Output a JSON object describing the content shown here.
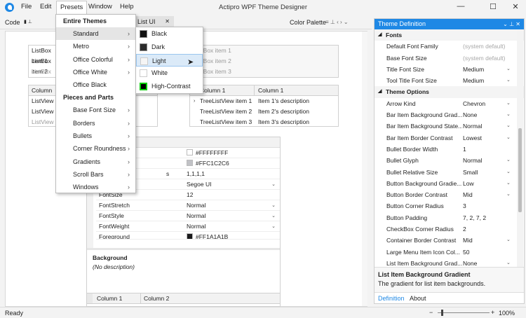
{
  "app": {
    "title": "Actipro WPF Theme Designer"
  },
  "menu": {
    "file": "File",
    "edit": "Edit",
    "presets": "Presets",
    "window": "Window",
    "help": "Help"
  },
  "window_buttons": {
    "minimize": "—",
    "maximize": "☐",
    "close": "✕"
  },
  "toolbar": {
    "code": "Code",
    "tab_listui": "List UI",
    "color_palette": "Color Palette"
  },
  "listbox1": {
    "items": [
      "ListBox item 1",
      "ListBox item 2",
      "ListBox item 3"
    ]
  },
  "listbox2": {
    "items": [
      "Disabled ListBox item 1",
      "Disabled ListBox item 2",
      "Disabled ListBox item 3"
    ]
  },
  "listview": {
    "column": "Column",
    "items": [
      "ListView item 1",
      "ListView item 2",
      "ListView item 3 (disabled)"
    ]
  },
  "treelistview": {
    "col1": "Column 1",
    "col2": "Column 1",
    "rows": [
      {
        "name": "TreeListView item 1",
        "desc": "Item 1's description"
      },
      {
        "name": "TreeListView item 2",
        "desc": "Item 2's description"
      },
      {
        "name": "TreeListView item 3",
        "desc": "Item 3's description"
      }
    ]
  },
  "propgrid": {
    "rows": [
      {
        "name": "",
        "value": "#FFFFFFFF"
      },
      {
        "name": "",
        "value": "#FFC1C2C6"
      },
      {
        "name": "s",
        "value": "1,1,1,1"
      },
      {
        "name": "",
        "value": "Segoe UI"
      },
      {
        "name": "FontSize",
        "value": "12"
      },
      {
        "name": "FontStretch",
        "value": "Normal"
      },
      {
        "name": "FontStyle",
        "value": "Normal"
      },
      {
        "name": "FontWeight",
        "value": "Normal"
      },
      {
        "name": "Foreground",
        "value": "#FF1A1A1B"
      }
    ],
    "desc_title": "Background",
    "desc_text": "(No description)"
  },
  "bottomgrid": {
    "col1": "Column 1",
    "col2": "Column 2"
  },
  "status": {
    "ready": "Ready",
    "zoom": "100%",
    "minus": "−",
    "plus": "+"
  },
  "presets_menu": {
    "head1": "Entire Themes",
    "items1": [
      "Standard",
      "Metro",
      "Office Colorful",
      "Office White",
      "Office Black"
    ],
    "head2": "Pieces and Parts",
    "items2": [
      "Base Font Size",
      "Borders",
      "Bullets",
      "Corner Roundness",
      "Gradients",
      "Scroll Bars",
      "Windows"
    ]
  },
  "standard_submenu": {
    "items": [
      {
        "label": "Black",
        "color": "#111111"
      },
      {
        "label": "Dark",
        "color": "#2b2b2b"
      },
      {
        "label": "Light",
        "color": "#f5f5f5"
      },
      {
        "label": "White",
        "color": "#ffffff"
      },
      {
        "label": "High-Contrast",
        "color": "#000000"
      }
    ]
  },
  "theme_definition": {
    "title": "Theme Definition",
    "fonts_header": "Fonts",
    "fonts": [
      {
        "name": "Default Font Family",
        "value": "(system default)",
        "placeholder": true
      },
      {
        "name": "Base Font Size",
        "value": "(system default)",
        "placeholder": true
      },
      {
        "name": "Title Font Size",
        "value": "Medium"
      },
      {
        "name": "Tool Title Font Size",
        "value": "Medium"
      }
    ],
    "options_header": "Theme Options",
    "options": [
      {
        "name": "Arrow Kind",
        "value": "Chevron",
        "dropdown": true
      },
      {
        "name": "Bar Item Background Grad...",
        "value": "None",
        "dropdown": true
      },
      {
        "name": "Bar Item Background State...",
        "value": "Normal",
        "dropdown": true
      },
      {
        "name": "Bar Item Border Contrast",
        "value": "Lowest",
        "dropdown": true
      },
      {
        "name": "Bullet Border Width",
        "value": "1",
        "dropdown": false
      },
      {
        "name": "Bullet Glyph",
        "value": "Normal",
        "dropdown": true
      },
      {
        "name": "Bullet Relative Size",
        "value": "Small",
        "dropdown": true
      },
      {
        "name": "Button Background Gradie...",
        "value": "Low",
        "dropdown": true
      },
      {
        "name": "Button Border Contrast",
        "value": "Mid",
        "dropdown": true
      },
      {
        "name": "Button Corner Radius",
        "value": "3",
        "dropdown": false
      },
      {
        "name": "Button Padding",
        "value": "7, 2, 7, 2",
        "dropdown": false
      },
      {
        "name": "CheckBox Corner Radius",
        "value": "2",
        "dropdown": false
      },
      {
        "name": "Container Border Contrast",
        "value": "Mid",
        "dropdown": true
      },
      {
        "name": "Large Menu Item Icon Col...",
        "value": "50",
        "dropdown": false
      },
      {
        "name": "List Item Background Grad...",
        "value": "None",
        "dropdown": true
      }
    ],
    "desc_title": "List Item Background Gradient",
    "desc_text": "The gradient for list item backgrounds.",
    "tab_definition": "Definition",
    "tab_about": "About"
  },
  "colors": {
    "accent": "#1e88e5"
  }
}
